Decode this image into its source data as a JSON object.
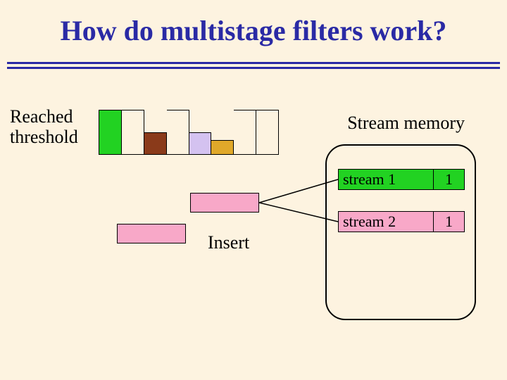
{
  "title": "How do multistage filters work?",
  "labels": {
    "reached": "Reached\nthreshold",
    "stream_memory": "Stream memory",
    "insert": "Insert"
  },
  "filter_cells": [
    {
      "color": "#22d222",
      "height": "full"
    },
    {
      "color": "transparent",
      "height": "full"
    },
    {
      "color": "#8a3a1a",
      "height": "half"
    },
    {
      "color": "transparent",
      "height": "full"
    },
    {
      "color": "#d4c2f0",
      "height": "half"
    },
    {
      "color": "#e0a82a",
      "height": "third"
    },
    {
      "color": "transparent",
      "height": "full"
    },
    {
      "color": "transparent",
      "height": "full"
    }
  ],
  "memory_entries": [
    {
      "name": "stream 1",
      "value": 1,
      "color": "#22d222"
    },
    {
      "name": "stream 2",
      "value": 1,
      "color": "#f8a8c8"
    }
  ]
}
